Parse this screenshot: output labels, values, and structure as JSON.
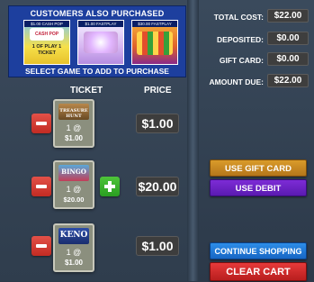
{
  "upsell": {
    "title": "CUSTOMERS ALSO PURCHASED",
    "instruction": "SELECT GAME TO ADD TO PURCHASE",
    "promos": [
      {
        "caption": "$1.00 CASH POP",
        "art_text": "1 OF PLAY 1 TICKET"
      },
      {
        "caption": "$1.00 FASTPLAY",
        "art_text": ""
      },
      {
        "caption": "$30.00 FASTPLAY",
        "art_text": ""
      }
    ]
  },
  "cart": {
    "columns": {
      "ticket": "TICKET",
      "price": "PRICE"
    },
    "items": [
      {
        "logo_text": "TREASURE HUNT",
        "qty_text": "1 @",
        "unit_price": "$1.00",
        "price": "$1.00"
      },
      {
        "logo_text": "BINGO",
        "qty_text": "1 @",
        "unit_price": "$20.00",
        "price": "$20.00"
      },
      {
        "logo_text": "KENO",
        "qty_text": "1 @",
        "unit_price": "$1.00",
        "price": "$1.00"
      }
    ]
  },
  "summary": {
    "total_cost": {
      "label": "TOTAL COST:",
      "value": "$22.00"
    },
    "deposited": {
      "label": "DEPOSITED:",
      "value": "$0.00"
    },
    "gift_card": {
      "label": "GIFT CARD:",
      "value": "$0.00"
    },
    "amount_due": {
      "label": "AMOUNT DUE:",
      "value": "$22.00"
    }
  },
  "actions": {
    "use_gift_card": "USE GIFT CARD",
    "use_debit": "USE DEBIT",
    "continue_shopping": "CONTINUE SHOPPING",
    "clear_cart": "CLEAR CART"
  },
  "colors": {
    "banner": "#1d3f9e",
    "minus": "#d1372e",
    "plus": "#2fa824",
    "gift": "#c8861f",
    "debit": "#6a22c4",
    "continue": "#2179d8",
    "clear": "#d12a2a"
  }
}
